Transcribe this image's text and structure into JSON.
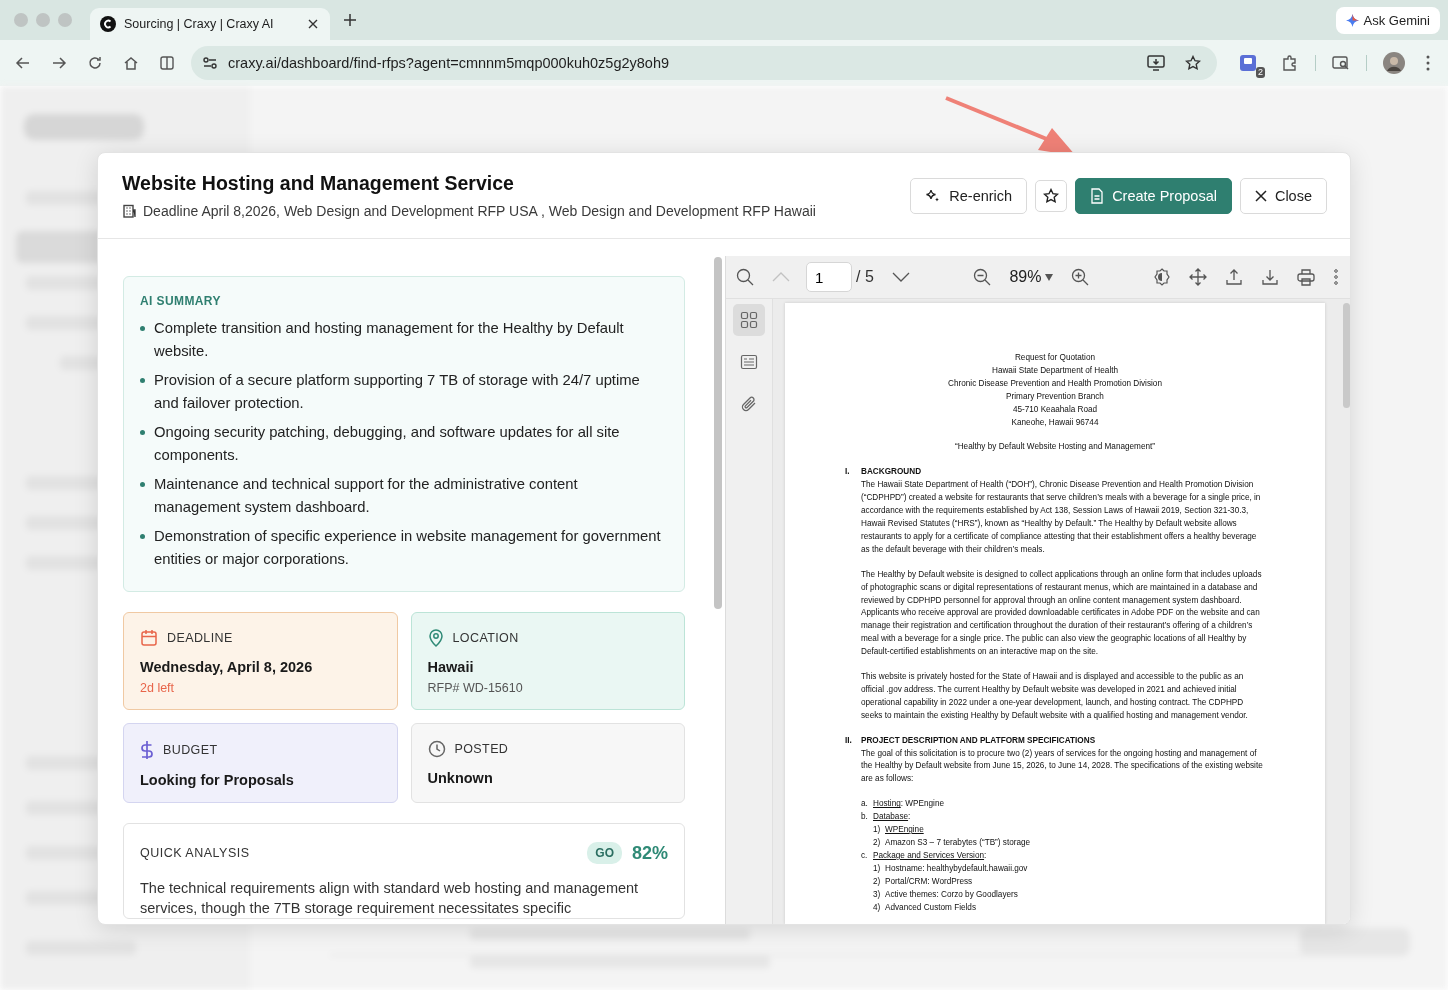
{
  "browser": {
    "tab_title": "Sourcing | Craxy | Craxy AI",
    "url": "craxy.ai/dashboard/find-rfps?agent=cmnnm5mqp000kuh0z5g2y8oh9",
    "gemini_label": "Ask Gemini",
    "extension_badge": "2"
  },
  "modal": {
    "title": "Website Hosting and Management Service",
    "subtitle": "Deadline April 8,2026, Web Design and Development RFP USA , Web Design and Development RFP Hawaii",
    "reenrich_label": "Re-enrich",
    "starred": false,
    "create_label": "Create Proposal",
    "close_label": "Close"
  },
  "ai_summary": {
    "heading": "AI SUMMARY",
    "points": [
      "Complete transition and hosting management for the Healthy by Default website.",
      "Provision of a secure platform supporting 7 TB of storage with 24/7 uptime and failover protection.",
      "Ongoing security patching, debugging, and software updates for all site components.",
      "Maintenance and technical support for the administrative content management system dashboard.",
      "Demonstration of specific experience in website management for government entities or major corporations."
    ]
  },
  "details": [
    {
      "kind": "deadline",
      "label": "DEADLINE",
      "value": "Wednesday, April 8, 2026",
      "note": "2d left"
    },
    {
      "kind": "location",
      "label": "LOCATION",
      "value": "Hawaii",
      "note": "RFP# WD-15610"
    },
    {
      "kind": "budget",
      "label": "BUDGET",
      "value": "Looking for Proposals"
    },
    {
      "kind": "posted",
      "label": "POSTED",
      "value": "Unknown"
    }
  ],
  "quick_analysis": {
    "heading": "QUICK ANALYSIS",
    "verdict": "GO",
    "score": "82%",
    "text": "The technical requirements align with standard web hosting and management services, though the 7TB storage requirement necessitates specific"
  },
  "pdf_viewer": {
    "page": "1",
    "page_count": "/ 5",
    "zoom": "89%",
    "panels": [
      {
        "kind": "thumbnails",
        "selected": true
      },
      {
        "kind": "outline",
        "selected": false
      },
      {
        "kind": "attachments",
        "selected": false
      }
    ],
    "document": {
      "header_lines": [
        "Request for Quotation",
        "Hawaii State Department of Health",
        "Chronic Disease Prevention and Health Promotion Division",
        "Primary Prevention Branch",
        "45-710 Keaahala Road",
        "Kaneohe, Hawaii 96744"
      ],
      "title": "“Healthy by Default Website Hosting and Management”",
      "sections": [
        {
          "number": "I.",
          "heading": "BACKGROUND",
          "paragraphs": [
            "The Hawaii State Department of Health (“DOH”), Chronic Disease Prevention and Health Promotion Division (“CDPHPD”) created a website for restaurants that serve children’s meals with a beverage for a single price, in accordance with the requirements established by Act 138, Session Laws of Hawaii 2019, Section 321-30.3, Hawaii Revised Statutes (“HRS”), known as “Healthy by Default.” The Healthy by Default website allows restaurants to apply for a certificate of compliance attesting that their establishment offers a healthy beverage as the default beverage with their children’s meals.",
            "The Healthy by Default website is designed to collect applications through an online form that includes uploads of photographic scans or digital representations of restaurant menus, which are maintained in a database and reviewed by CDPHPD personnel for approval through an online content management system dashboard. Applicants who receive approval are provided downloadable certificates in Adobe PDF on the website and can manage their registration and certification throughout the duration of their restaurant’s offering of a children’s meal with a beverage for a single price. The public can also view the geographic locations of all Healthy by Default-certified establishments on an interactive map on the site.",
            "This website is privately hosted for the State of Hawaii and is displayed and accessible to the public as an official .gov address. The current Healthy by Default website was developed in 2021 and achieved initial operational capability in 2022 under a one-year development, launch, and hosting contract. The CDPHPD seeks to maintain the existing Healthy by Default website with a qualified hosting and management vendor."
          ]
        },
        {
          "number": "II.",
          "heading": "PROJECT DESCRIPTION AND PLATFORM SPECIFICATIONS",
          "paragraphs": [
            "The goal of this solicitation is to procure two (2) years of services for the ongoing hosting and management of the Healthy by Default website from June 15, 2026, to June 14, 2028. The specifications of the existing website are as follows:"
          ],
          "items": [
            {
              "marker": "a.",
              "label": "Hosting",
              "text": ": WPEngine"
            },
            {
              "marker": "b.",
              "label": "Database",
              "text": ":",
              "children": [
                {
                  "marker": "1)",
                  "label": "WPEngine"
                },
                {
                  "marker": "2)",
                  "text": "Amazon S3 – 7 terabytes (“TB”) storage"
                }
              ]
            },
            {
              "marker": "c.",
              "label": "Package and Services Version",
              "text": ":",
              "children": [
                {
                  "marker": "1)",
                  "text": "Hostname: healthybydefault.hawaii.gov"
                },
                {
                  "marker": "2)",
                  "text": "Portal/CRM: WordPress"
                },
                {
                  "marker": "3)",
                  "text": "Active themes: Corzo by Goodlayers"
                },
                {
                  "marker": "4)",
                  "text": "Advanced Custom Fields"
                }
              ]
            }
          ]
        }
      ]
    }
  }
}
